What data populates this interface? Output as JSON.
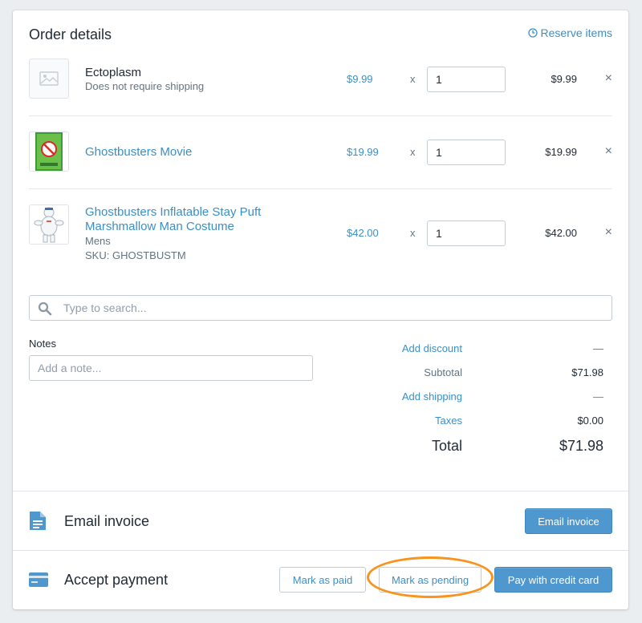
{
  "order": {
    "title": "Order details",
    "reserve_label": "Reserve items",
    "items": [
      {
        "name": "Ectoplasm",
        "sub": "Does not require shipping",
        "price": "$9.99",
        "times": "x",
        "qty": "1",
        "total": "$9.99"
      },
      {
        "name": "Ghostbusters Movie",
        "price": "$19.99",
        "times": "x",
        "qty": "1",
        "total": "$19.99"
      },
      {
        "name_line1": "Ghostbusters Inflatable Stay Puft",
        "name_line2": "Marshmallow Man Costume",
        "variant": "Mens",
        "sku": "SKU: GHOSTBUSTM",
        "price": "$42.00",
        "times": "x",
        "qty": "1",
        "total": "$42.00"
      }
    ],
    "remove_glyph": "×",
    "search_placeholder": "Type to search...",
    "notes_label": "Notes",
    "notes_placeholder": "Add a note...",
    "summary": {
      "discount_label": "Add discount",
      "discount_value": "—",
      "subtotal_label": "Subtotal",
      "subtotal_value": "$71.98",
      "shipping_label": "Add shipping",
      "shipping_value": "—",
      "taxes_label": "Taxes",
      "taxes_value": "$0.00",
      "total_label": "Total",
      "total_value": "$71.98"
    }
  },
  "invoice": {
    "title": "Email invoice",
    "button": "Email invoice"
  },
  "payment": {
    "title": "Accept payment",
    "mark_paid": "Mark as paid",
    "mark_pending": "Mark as pending",
    "pay_card": "Pay with credit card"
  },
  "colors": {
    "accent": "#3a8fc8",
    "primary_button": "#4f97cf",
    "highlight": "#f7941d"
  },
  "icons": [
    "clock-icon",
    "image-placeholder-icon",
    "close-icon",
    "search-icon",
    "document-icon",
    "credit-card-icon"
  ]
}
